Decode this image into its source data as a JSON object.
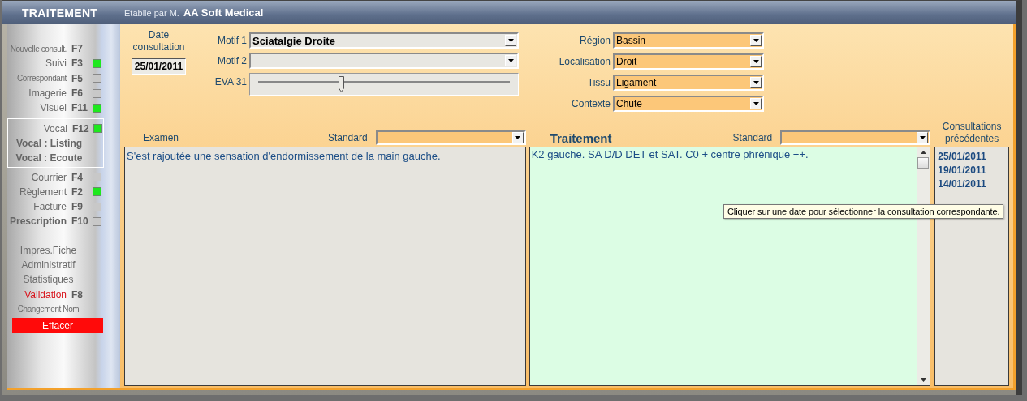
{
  "window": {
    "title": "TRAITEMENT",
    "subtitle": "Etablie par M.",
    "author": "AA Soft Medical"
  },
  "sidebar": {
    "groups": [
      {
        "framed": false,
        "items": [
          {
            "label": "Nouvelle consult.",
            "key": "F7",
            "kind": "small"
          },
          {
            "label": "Suivi",
            "key": "F3",
            "kind": "normal",
            "lit": true
          },
          {
            "label": "Correspondant",
            "key": "F5",
            "kind": "small",
            "lit": false
          },
          {
            "label": "Imagerie",
            "key": "F6",
            "kind": "normal",
            "lit": false
          },
          {
            "label": "Visuel",
            "key": "F11",
            "kind": "normal",
            "lit": true
          }
        ]
      },
      {
        "framed": true,
        "items": [
          {
            "label": "Vocal",
            "key": "F12",
            "kind": "normal",
            "lit": true
          },
          {
            "label": "Vocal : Listing",
            "kind": "bold"
          },
          {
            "label": "Vocal : Ecoute",
            "kind": "bold"
          }
        ]
      },
      {
        "framed": false,
        "items": [
          {
            "label": "Courrier",
            "key": "F4",
            "kind": "normal",
            "lit": false
          },
          {
            "label": "Règlement",
            "key": "F2",
            "kind": "normal",
            "lit": true
          },
          {
            "label": "Facture",
            "key": "F9",
            "kind": "normal",
            "lit": false
          },
          {
            "label": "Prescription",
            "key": "F10",
            "kind": "bold",
            "lit": false
          }
        ]
      },
      {
        "framed": false,
        "items": [
          {
            "label": "Impres.Fiche",
            "kind": "normal"
          },
          {
            "label": "Administratif",
            "kind": "normal"
          },
          {
            "label": "Statistiques",
            "kind": "normal"
          },
          {
            "label": "Validation",
            "key": "F8",
            "kind": "alert"
          },
          {
            "label": "Changement Nom",
            "kind": "small"
          }
        ]
      }
    ],
    "danger_button": "Effacer"
  },
  "date": {
    "label": "Date consultation",
    "value": "25/01/2011"
  },
  "motifs": [
    {
      "label": "Motif 1",
      "value": "Sciatalgie Droite"
    },
    {
      "label": "Motif 2"
    }
  ],
  "eva": {
    "label": "EVA 31",
    "level": 0.33
  },
  "location_fields": [
    {
      "label": "Région",
      "value": "Bassin"
    },
    {
      "label": "Localisation",
      "value": "Droit"
    },
    {
      "label": "Tissu",
      "value": "Ligament"
    },
    {
      "label": "Contexte",
      "value": "Chute"
    }
  ],
  "examen": {
    "label": "Examen",
    "standard_label": "Standard",
    "text": "S'est rajoutée une sensation d'endormissement de la main gauche."
  },
  "traitement": {
    "label": "Traitement",
    "standard_label": "Standard",
    "text": "K2 gauche. SA D/D DET et SAT. C0 + centre phrénique ++."
  },
  "history": {
    "title": "Consultations précédentes",
    "dates": [
      "25/01/2011",
      "19/01/2011",
      "14/01/2011"
    ]
  },
  "tooltip": "Cliquer sur une date pour sélectionner la consultation correspondante."
}
